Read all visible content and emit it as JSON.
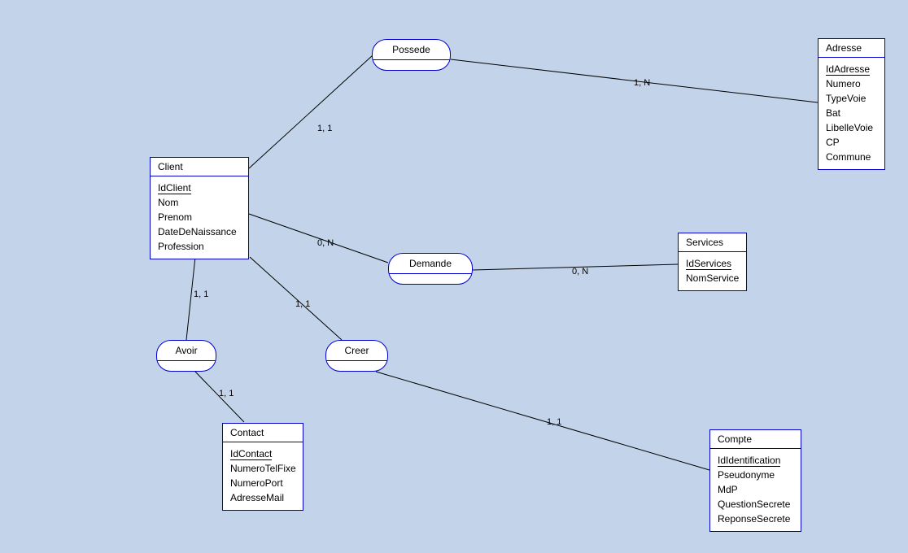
{
  "diagram": {
    "type": "entity-relationship-diagram",
    "background_color": "#c3d4ea",
    "entity_fill": "#ffffff",
    "entity_border": "#0000cc",
    "entities": [
      {
        "name": "Client",
        "key": "IdClient",
        "attributes": [
          "IdClient",
          "Nom",
          "Prenom",
          "DateDeNaissance",
          "Profession"
        ]
      },
      {
        "name": "Adresse",
        "key": "IdAdresse",
        "attributes": [
          "IdAdresse",
          "Numero",
          "TypeVoie",
          "Bat",
          "LibelleVoie",
          "CP",
          "Commune"
        ]
      },
      {
        "name": "Services",
        "key": "IdServices",
        "attributes": [
          "IdServices",
          "NomService"
        ]
      },
      {
        "name": "Contact",
        "key": "IdContact",
        "attributes": [
          "IdContact",
          "NumeroTelFixe",
          "NumeroPort",
          "AdresseMail"
        ]
      },
      {
        "name": "Compte",
        "key": "IdIdentification",
        "attributes": [
          "IdIdentification",
          "Pseudonyme",
          "MdP",
          "QuestionSecrete",
          "ReponseSecrete"
        ]
      }
    ],
    "relationships": [
      {
        "name": "Possede"
      },
      {
        "name": "Demande"
      },
      {
        "name": "Avoir"
      },
      {
        "name": "Creer"
      }
    ],
    "cardinalities": [
      {
        "id": "client-possede",
        "label": "1, 1"
      },
      {
        "id": "possede-adresse",
        "label": "1, N"
      },
      {
        "id": "client-demande",
        "label": "0, N"
      },
      {
        "id": "demande-services",
        "label": "0, N"
      },
      {
        "id": "client-avoir",
        "label": "1, 1"
      },
      {
        "id": "avoir-contact",
        "label": "1, 1"
      },
      {
        "id": "client-creer",
        "label": "1, 1"
      },
      {
        "id": "creer-compte",
        "label": "1, 1"
      }
    ]
  }
}
